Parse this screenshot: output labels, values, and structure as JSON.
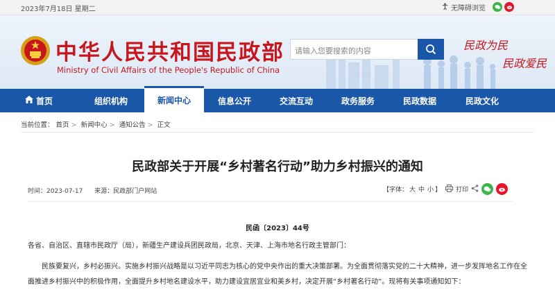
{
  "topbar": {
    "date": "2023年7月18日 星期二",
    "accessibility": "无障碍浏览",
    "social_icons": [
      "wechat-icon",
      "weibo-icon"
    ]
  },
  "header": {
    "brand_cn": "中华人民共和国民政部",
    "brand_en": "Ministry of Civil Affairs of the People's Republic of China",
    "search_placeholder": "请输入您要搜索的内容",
    "slogan_1": "民政为民",
    "slogan_2": "民政爱民"
  },
  "nav": {
    "items": [
      "首页",
      "组织机构",
      "新闻中心",
      "信息公开",
      "交流互动",
      "政务服务",
      "民政数据",
      "民政文化"
    ],
    "active": "新闻中心"
  },
  "breadcrumb": {
    "label": "当前位置：",
    "items": [
      "首页",
      "新闻中心",
      "通知公告",
      "正文"
    ]
  },
  "article": {
    "title": "民政部关于开展“乡村著名行动”助力乡村振兴的通知",
    "time": "时间：2023-07-17",
    "source": "来源：民政部门户网站",
    "font_label": "【字体：",
    "font_sizes": [
      "大",
      "中",
      "小"
    ],
    "font_close": "】",
    "print_label": "打印",
    "doc_no": "民函〔2023〕44号",
    "para_1": "各省、自治区、直辖市民政厅（局），新疆生产建设兵团民政局，北京、天津、上海市地名行政主管部门：",
    "para_2": "民族要复兴，乡村必振兴。实施乡村振兴战略是以习近平同志为核心的党中央作出的重大决策部署。为全面贯彻落实党的二十大精神，进一步发挥地名工作在全面推进乡村振兴中的积极作用，全面提升乡村地名建设水平，助力建设宜居宜业和美乡村，决定开展“乡村著名行动”。现将有关事项通知如下："
  },
  "colors": {
    "brand_red": "#c8161d",
    "nav_blue": "#1a57a8"
  }
}
